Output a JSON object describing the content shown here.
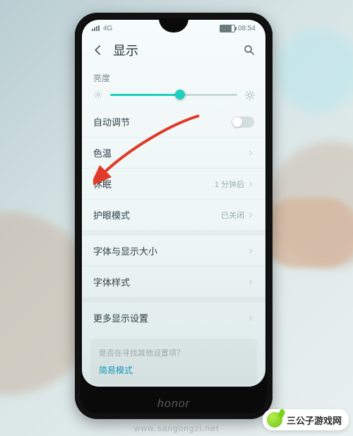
{
  "status": {
    "network": "4G",
    "time": "08:54"
  },
  "header": {
    "title": "显示"
  },
  "brightness": {
    "label": "亮度",
    "percent": 55,
    "auto_label": "自动调节",
    "auto_on": false
  },
  "rows": {
    "color_temp": {
      "label": "色温"
    },
    "sleep": {
      "label": "休眠",
      "value": "1 分钟后"
    },
    "eye_care": {
      "label": "护眼模式",
      "value": "已关闭"
    },
    "font_size": {
      "label": "字体与显示大小"
    },
    "font_style": {
      "label": "字体样式"
    },
    "more": {
      "label": "更多显示设置"
    }
  },
  "search_card": {
    "question": "是否在寻找其他设置项？",
    "link": "简易模式"
  },
  "brand": "honor",
  "watermark": "www.sangongzi.net",
  "site_logo": "三公子游戏网"
}
